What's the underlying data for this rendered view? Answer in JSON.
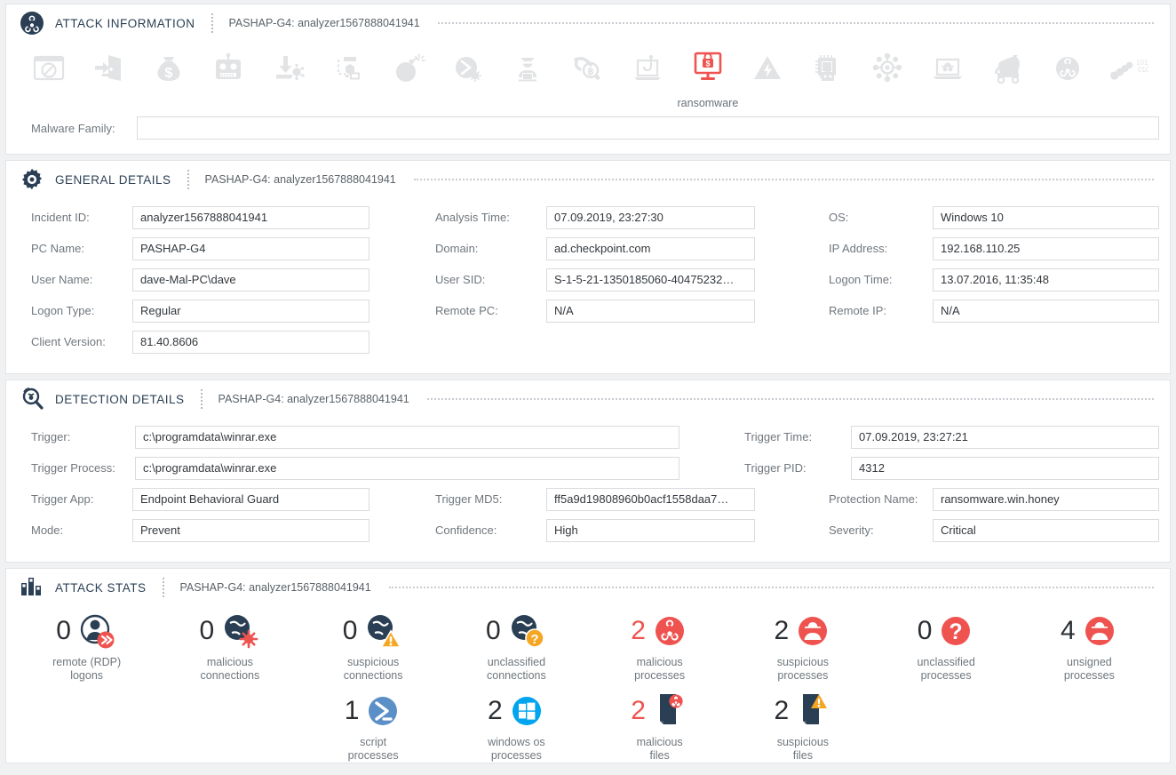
{
  "attack_information": {
    "title": "ATTACK INFORMATION",
    "subtitle": "PASHAP-G4: analyzer1567888041941",
    "icon": "biohazard-icon",
    "attack_types": [
      {
        "name": "blocked-website-icon",
        "label": "",
        "selected": false
      },
      {
        "name": "intrusion-door-icon",
        "label": "",
        "selected": false
      },
      {
        "name": "money-bag-icon",
        "label": "",
        "selected": false
      },
      {
        "name": "bot-icon",
        "label": "",
        "selected": false
      },
      {
        "name": "drive-by-download-icon",
        "label": "",
        "selected": false
      },
      {
        "name": "data-exfiltration-icon",
        "label": "",
        "selected": false
      },
      {
        "name": "bomb-icon",
        "label": "",
        "selected": false
      },
      {
        "name": "script-attack-icon",
        "label": "",
        "selected": false
      },
      {
        "name": "hacker-icon",
        "label": "",
        "selected": false
      },
      {
        "name": "crypto-mining-icon",
        "label": "",
        "selected": false
      },
      {
        "name": "phishing-icon",
        "label": "",
        "selected": false
      },
      {
        "name": "ransomware-icon",
        "label": "ransomware",
        "selected": true
      },
      {
        "name": "exploit-icon",
        "label": "",
        "selected": false
      },
      {
        "name": "rootkit-icon",
        "label": "",
        "selected": false
      },
      {
        "name": "botnet-icon",
        "label": "",
        "selected": false
      },
      {
        "name": "spyware-icon",
        "label": "",
        "selected": false
      },
      {
        "name": "trojan-horse-icon",
        "label": "",
        "selected": false
      },
      {
        "name": "virus-icon",
        "label": "",
        "selected": false
      },
      {
        "name": "worm-icon",
        "label": "",
        "selected": false
      }
    ],
    "malware_family": {
      "label": "Malware Family:",
      "value": "",
      "placeholder": ""
    }
  },
  "general_details": {
    "title": "GENERAL DETAILS",
    "subtitle": "PASHAP-G4: analyzer1567888041941",
    "icon": "gear-icon",
    "column1": [
      {
        "label": "Incident ID:",
        "value": "analyzer1567888041941"
      },
      {
        "label": "PC Name:",
        "value": "PASHAP-G4"
      },
      {
        "label": "User Name:",
        "value": "dave-Mal-PC\\dave"
      },
      {
        "label": "Logon Type:",
        "value": "Regular"
      },
      {
        "label": "Client Version:",
        "value": "81.40.8606"
      }
    ],
    "column2": [
      {
        "label": "Analysis Time:",
        "value": "07.09.2019, 23:27:30"
      },
      {
        "label": "Domain:",
        "value": "ad.checkpoint.com"
      },
      {
        "label": "User SID:",
        "value": "S-1-5-21-1350185060-40475232…"
      },
      {
        "label": "Remote PC:",
        "value": "N/A"
      }
    ],
    "column3": [
      {
        "label": "OS:",
        "value": "Windows 10"
      },
      {
        "label": "IP Address:",
        "value": "192.168.110.25"
      },
      {
        "label": "Logon Time:",
        "value": "13.07.2016, 11:35:48"
      },
      {
        "label": "Remote IP:",
        "value": "N/A"
      }
    ]
  },
  "detection_details": {
    "title": "DETECTION DETAILS",
    "subtitle": "PASHAP-G4: analyzer1567888041941",
    "icon": "magnifier-search-icon",
    "top_left": [
      {
        "label": "Trigger:",
        "value": "c:\\programdata\\winrar.exe"
      },
      {
        "label": "Trigger Process:",
        "value": "c:\\programdata\\winrar.exe"
      }
    ],
    "top_right": [
      {
        "label": "Trigger Time:",
        "value": "07.09.2019, 23:27:21"
      },
      {
        "label": "Trigger PID:",
        "value": "4312"
      }
    ],
    "bottom_col1": [
      {
        "label": "Trigger App:",
        "value": "Endpoint Behavioral Guard"
      },
      {
        "label": "Mode:",
        "value": "Prevent"
      }
    ],
    "bottom_col2": [
      {
        "label": "Trigger MD5:",
        "value": "ff5a9d19808960b0acf1558daa7…"
      },
      {
        "label": "Confidence:",
        "value": "High"
      }
    ],
    "bottom_col3": [
      {
        "label": "Protection Name:",
        "value": "ransomware.win.honey"
      },
      {
        "label": "Severity:",
        "value": "Critical"
      }
    ]
  },
  "attack_stats": {
    "title": "ATTACK STATS",
    "subtitle": "PASHAP-G4: analyzer1567888041941",
    "icon": "bar-chart-icon",
    "row1": [
      {
        "count": "0",
        "label": "remote (RDP)\nlogons",
        "icon": "rdp-logon-icon",
        "red_number": false
      },
      {
        "count": "0",
        "label": "malicious\nconnections",
        "icon": "malicious-connection-icon",
        "red_number": false
      },
      {
        "count": "0",
        "label": "suspicious\nconnections",
        "icon": "suspicious-connection-icon",
        "red_number": false
      },
      {
        "count": "0",
        "label": "unclassified\nconnections",
        "icon": "unclassified-connection-icon",
        "red_number": false
      },
      {
        "count": "2",
        "label": "malicious\nprocesses",
        "icon": "malicious-process-icon",
        "red_number": true
      },
      {
        "count": "2",
        "label": "suspicious\nprocesses",
        "icon": "suspicious-process-icon",
        "red_number": false
      },
      {
        "count": "0",
        "label": "unclassified\nprocesses",
        "icon": "unclassified-process-icon",
        "red_number": false
      },
      {
        "count": "4",
        "label": "unsigned\nprocesses",
        "icon": "unsigned-process-icon",
        "red_number": false
      }
    ],
    "row2": [
      {
        "count": "1",
        "label": "script\nprocesses",
        "icon": "powershell-script-icon",
        "red_number": false
      },
      {
        "count": "2",
        "label": "windows os\nprocesses",
        "icon": "windows-os-icon",
        "red_number": false
      },
      {
        "count": "2",
        "label": "malicious\nfiles",
        "icon": "malicious-file-icon",
        "red_number": true
      },
      {
        "count": "2",
        "label": "suspicious\nfiles",
        "icon": "suspicious-file-icon",
        "red_number": false
      }
    ]
  },
  "colors": {
    "accent_red": "#ef5350",
    "navy": "#2a3f54",
    "amber": "#f5a623",
    "powershell_blue": "#5b8fc7",
    "windows_blue": "#00a4ef",
    "icon_grey": "#e2e3e5"
  }
}
